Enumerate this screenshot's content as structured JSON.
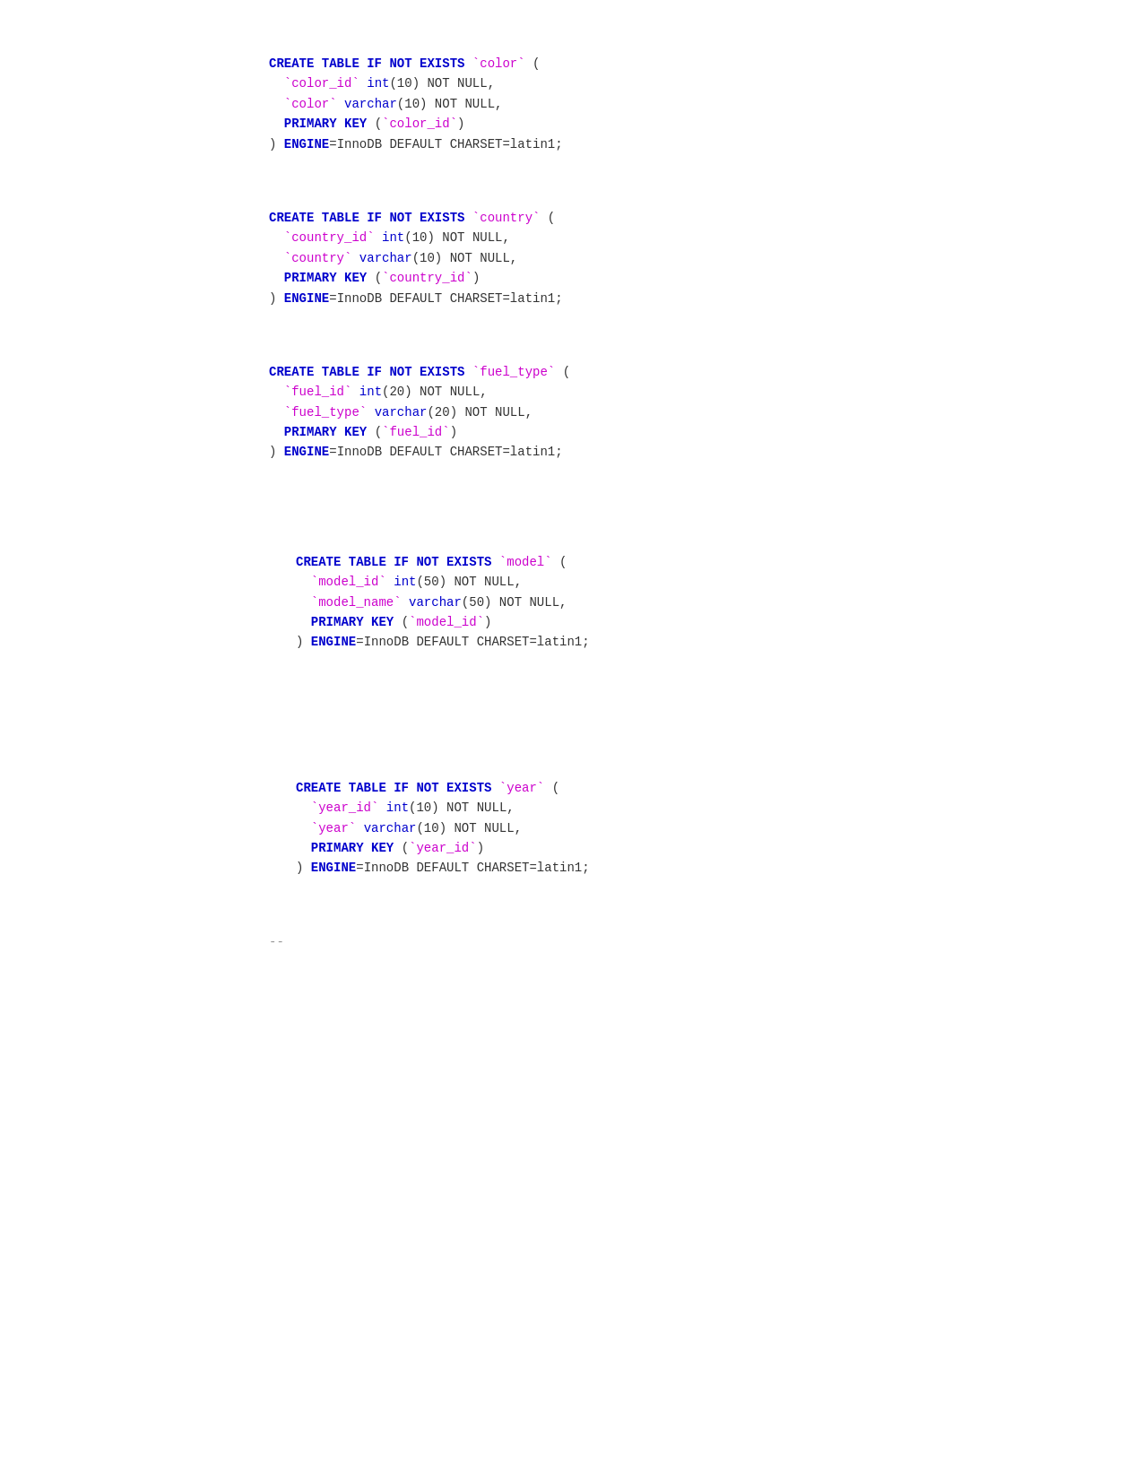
{
  "blocks": [
    {
      "id": "color-table",
      "indented": false,
      "lines": [
        {
          "parts": [
            {
              "text": "CREATE TABLE IF NOT EXISTS ",
              "cls": "kw"
            },
            {
              "text": "`color`",
              "cls": "tick"
            },
            {
              "text": " (",
              "cls": "plain"
            }
          ]
        },
        {
          "parts": [
            {
              "text": "  ",
              "cls": "plain"
            },
            {
              "text": "`color_id`",
              "cls": "tick"
            },
            {
              "text": " ",
              "cls": "plain"
            },
            {
              "text": "int",
              "cls": "type"
            },
            {
              "text": "(10) NOT NULL,",
              "cls": "plain"
            }
          ]
        },
        {
          "parts": [
            {
              "text": "  ",
              "cls": "plain"
            },
            {
              "text": "`color`",
              "cls": "tick"
            },
            {
              "text": " ",
              "cls": "plain"
            },
            {
              "text": "varchar",
              "cls": "type"
            },
            {
              "text": "(10) NOT NULL,",
              "cls": "plain"
            }
          ]
        },
        {
          "parts": [
            {
              "text": "  ",
              "cls": "plain"
            },
            {
              "text": "PRIMARY KEY",
              "cls": "kw"
            },
            {
              "text": " (",
              "cls": "plain"
            },
            {
              "text": "`color_id`",
              "cls": "tick"
            },
            {
              "text": ")",
              "cls": "plain"
            }
          ]
        },
        {
          "parts": [
            {
              "text": ") ",
              "cls": "plain"
            },
            {
              "text": "ENGINE",
              "cls": "kw"
            },
            {
              "text": "=InnoDB DEFAULT CHARSET=latin1;",
              "cls": "plain"
            }
          ]
        }
      ]
    },
    {
      "id": "country-table",
      "indented": false,
      "lines": [
        {
          "parts": [
            {
              "text": "CREATE TABLE IF NOT EXISTS ",
              "cls": "kw"
            },
            {
              "text": "`country`",
              "cls": "tick"
            },
            {
              "text": " (",
              "cls": "plain"
            }
          ]
        },
        {
          "parts": [
            {
              "text": "  ",
              "cls": "plain"
            },
            {
              "text": "`country_id`",
              "cls": "tick"
            },
            {
              "text": " ",
              "cls": "plain"
            },
            {
              "text": "int",
              "cls": "type"
            },
            {
              "text": "(10) NOT NULL,",
              "cls": "plain"
            }
          ]
        },
        {
          "parts": [
            {
              "text": "  ",
              "cls": "plain"
            },
            {
              "text": "`country`",
              "cls": "tick"
            },
            {
              "text": " ",
              "cls": "plain"
            },
            {
              "text": "varchar",
              "cls": "type"
            },
            {
              "text": "(10) NOT NULL,",
              "cls": "plain"
            }
          ]
        },
        {
          "parts": [
            {
              "text": "  ",
              "cls": "plain"
            },
            {
              "text": "PRIMARY KEY",
              "cls": "kw"
            },
            {
              "text": " (",
              "cls": "plain"
            },
            {
              "text": "`country_id`",
              "cls": "tick"
            },
            {
              "text": ")",
              "cls": "plain"
            }
          ]
        },
        {
          "parts": [
            {
              "text": ") ",
              "cls": "plain"
            },
            {
              "text": "ENGINE",
              "cls": "kw"
            },
            {
              "text": "=InnoDB DEFAULT CHARSET=latin1;",
              "cls": "plain"
            }
          ]
        }
      ]
    },
    {
      "id": "fuel-type-table",
      "indented": false,
      "lines": [
        {
          "parts": [
            {
              "text": "CREATE TABLE IF NOT EXISTS ",
              "cls": "kw"
            },
            {
              "text": "`fuel_type`",
              "cls": "tick"
            },
            {
              "text": " (",
              "cls": "plain"
            }
          ]
        },
        {
          "parts": [
            {
              "text": "  ",
              "cls": "plain"
            },
            {
              "text": "`fuel_id`",
              "cls": "tick"
            },
            {
              "text": " ",
              "cls": "plain"
            },
            {
              "text": "int",
              "cls": "type"
            },
            {
              "text": "(20) NOT NULL,",
              "cls": "plain"
            }
          ]
        },
        {
          "parts": [
            {
              "text": "  ",
              "cls": "plain"
            },
            {
              "text": "`fuel_type`",
              "cls": "tick"
            },
            {
              "text": " ",
              "cls": "plain"
            },
            {
              "text": "varchar",
              "cls": "type"
            },
            {
              "text": "(20) NOT NULL,",
              "cls": "plain"
            }
          ]
        },
        {
          "parts": [
            {
              "text": "  ",
              "cls": "plain"
            },
            {
              "text": "PRIMARY KEY",
              "cls": "kw"
            },
            {
              "text": " (",
              "cls": "plain"
            },
            {
              "text": "`fuel_id`",
              "cls": "tick"
            },
            {
              "text": ")",
              "cls": "plain"
            }
          ]
        },
        {
          "parts": [
            {
              "text": ") ",
              "cls": "plain"
            },
            {
              "text": "ENGINE",
              "cls": "kw"
            },
            {
              "text": "=InnoDB DEFAULT CHARSET=latin1;",
              "cls": "plain"
            }
          ]
        }
      ]
    },
    {
      "id": "model-table",
      "indented": true,
      "lines": [
        {
          "parts": [
            {
              "text": "CREATE TABLE IF NOT EXISTS ",
              "cls": "kw"
            },
            {
              "text": "`model`",
              "cls": "tick"
            },
            {
              "text": " (",
              "cls": "plain"
            }
          ]
        },
        {
          "parts": [
            {
              "text": "  ",
              "cls": "plain"
            },
            {
              "text": "`model_id`",
              "cls": "tick"
            },
            {
              "text": " ",
              "cls": "plain"
            },
            {
              "text": "int",
              "cls": "type"
            },
            {
              "text": "(50) NOT NULL,",
              "cls": "plain"
            }
          ]
        },
        {
          "parts": [
            {
              "text": "  ",
              "cls": "plain"
            },
            {
              "text": "`model_name`",
              "cls": "tick"
            },
            {
              "text": " ",
              "cls": "plain"
            },
            {
              "text": "varchar",
              "cls": "type"
            },
            {
              "text": "(50) NOT NULL,",
              "cls": "plain"
            }
          ]
        },
        {
          "parts": [
            {
              "text": "  ",
              "cls": "plain"
            },
            {
              "text": "PRIMARY KEY",
              "cls": "kw"
            },
            {
              "text": " (",
              "cls": "plain"
            },
            {
              "text": "`model_id`",
              "cls": "tick"
            },
            {
              "text": ")",
              "cls": "plain"
            }
          ]
        },
        {
          "parts": [
            {
              "text": ") ",
              "cls": "plain"
            },
            {
              "text": "ENGINE",
              "cls": "kw"
            },
            {
              "text": "=InnoDB DEFAULT CHARSET=latin1;",
              "cls": "plain"
            }
          ]
        }
      ]
    },
    {
      "id": "year-table",
      "indented": true,
      "lines": [
        {
          "parts": [
            {
              "text": "CREATE TABLE IF NOT EXISTS ",
              "cls": "kw"
            },
            {
              "text": "`year`",
              "cls": "tick"
            },
            {
              "text": " (",
              "cls": "plain"
            }
          ]
        },
        {
          "parts": [
            {
              "text": "  ",
              "cls": "plain"
            },
            {
              "text": "`year_id`",
              "cls": "tick"
            },
            {
              "text": " ",
              "cls": "plain"
            },
            {
              "text": "int",
              "cls": "type"
            },
            {
              "text": "(10) NOT NULL,",
              "cls": "plain"
            }
          ]
        },
        {
          "parts": [
            {
              "text": "  ",
              "cls": "plain"
            },
            {
              "text": "`year`",
              "cls": "tick"
            },
            {
              "text": " ",
              "cls": "plain"
            },
            {
              "text": "varchar",
              "cls": "type"
            },
            {
              "text": "(10) NOT NULL,",
              "cls": "plain"
            }
          ]
        },
        {
          "parts": [
            {
              "text": "  ",
              "cls": "plain"
            },
            {
              "text": "PRIMARY KEY",
              "cls": "kw"
            },
            {
              "text": " (",
              "cls": "plain"
            },
            {
              "text": "`year_id`",
              "cls": "tick"
            },
            {
              "text": ")",
              "cls": "plain"
            }
          ]
        },
        {
          "parts": [
            {
              "text": ") ",
              "cls": "plain"
            },
            {
              "text": "ENGINE",
              "cls": "kw"
            },
            {
              "text": "=InnoDB DEFAULT CHARSET=latin1;",
              "cls": "plain"
            }
          ]
        }
      ]
    }
  ],
  "comment": "--"
}
